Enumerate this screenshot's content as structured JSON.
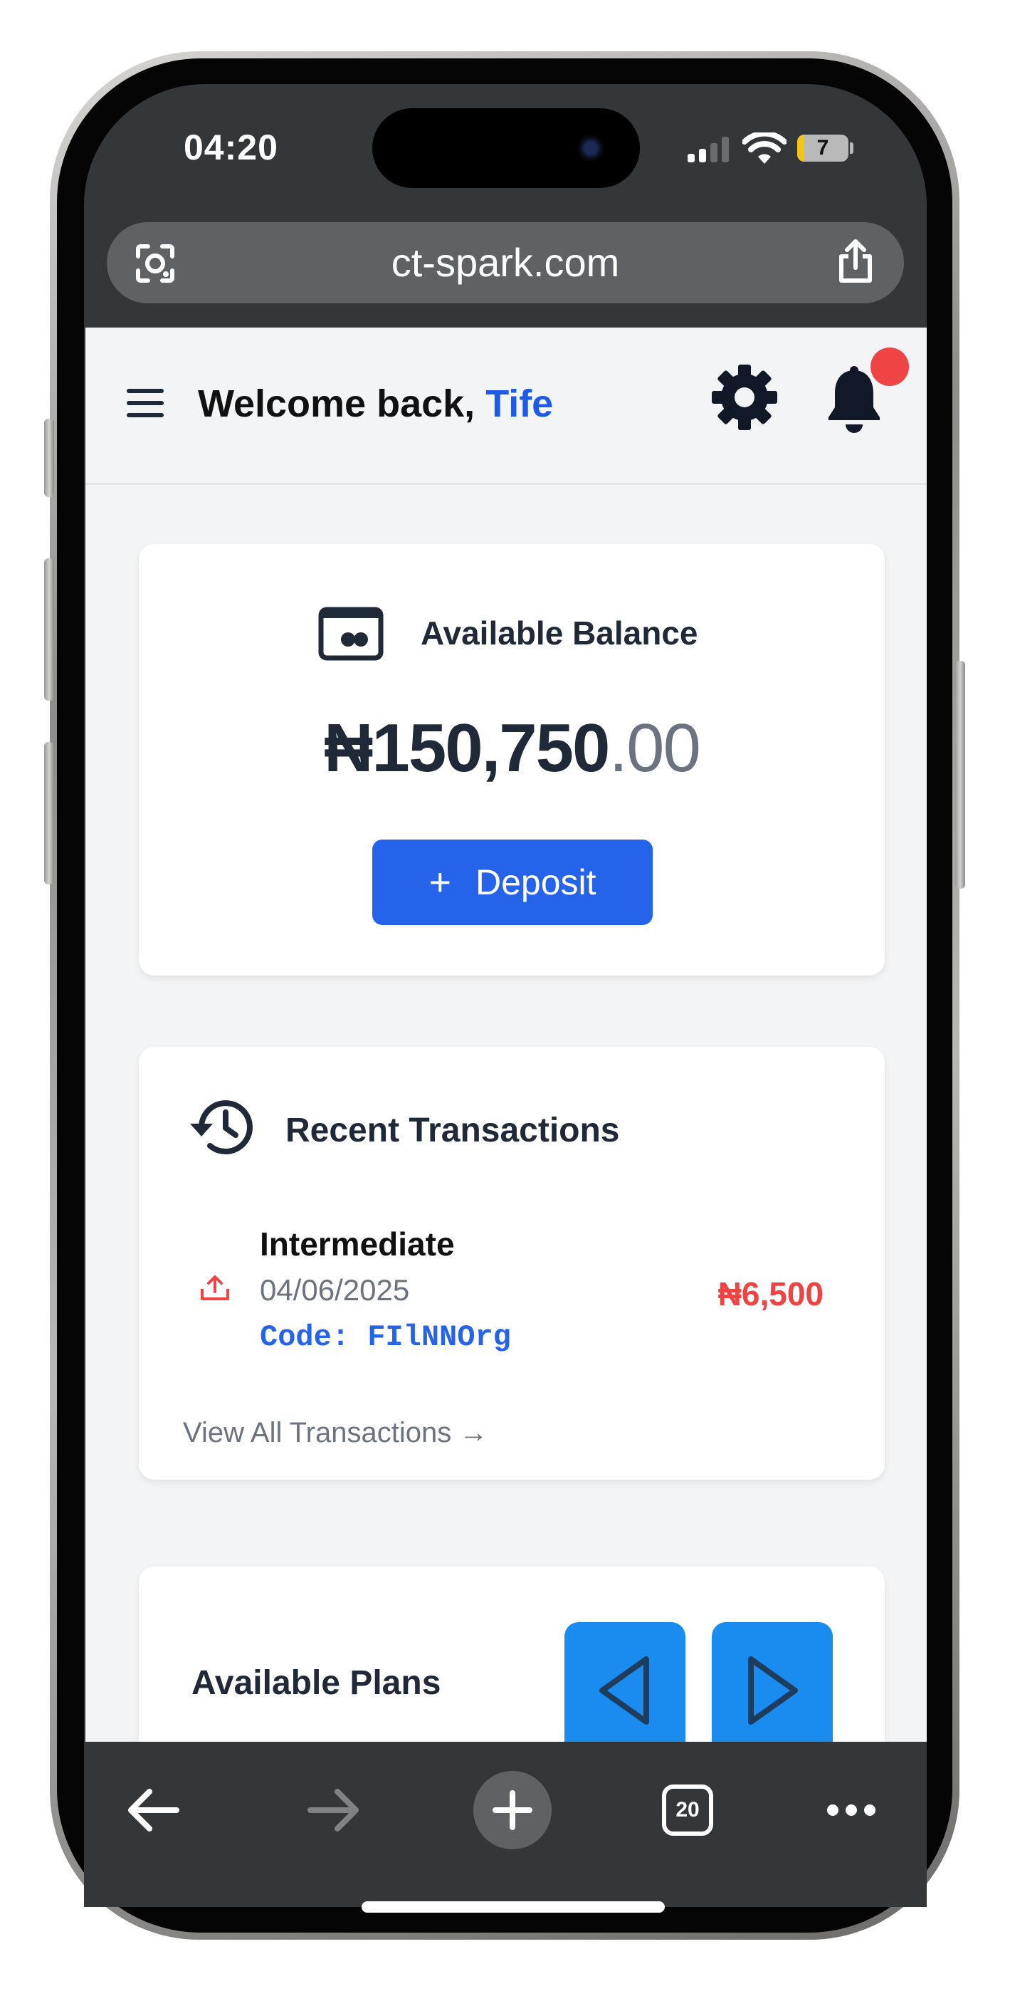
{
  "status_bar": {
    "time": "04:20",
    "battery": "7"
  },
  "browser": {
    "url": "ct-spark.com",
    "tab_count": "20"
  },
  "header": {
    "welcome_prefix": "Welcome back, ",
    "user_name": "Tife",
    "has_notifications": true
  },
  "balance": {
    "label": "Available Balance",
    "amount_main": "₦150,750",
    "amount_cents": ".00",
    "deposit_plus": "+",
    "deposit_label": "Deposit"
  },
  "transactions": {
    "title": "Recent Transactions",
    "items": [
      {
        "name": "Intermediate",
        "date": "04/06/2025",
        "code": "Code: FIlNNOrg",
        "amount": "₦6,500",
        "direction": "outgoing"
      }
    ],
    "view_all": "View All Transactions →"
  },
  "plans": {
    "title": "Available Plans"
  },
  "colors": {
    "accent": "#2563eb",
    "name_blue": "#1d5ae6",
    "negative": "#ef4444",
    "nav_button": "#1a8cf0",
    "page_bg": "#f3f4f6"
  },
  "icons": [
    "menu-icon",
    "gear-icon",
    "bell-icon",
    "wallet-icon",
    "history-icon",
    "upload-icon",
    "triangle-left-icon",
    "triangle-right-icon",
    "back-arrow-icon",
    "forward-arrow-icon",
    "plus-icon",
    "tabs-icon",
    "more-icon",
    "lens-icon",
    "share-icon",
    "signal-icon",
    "wifi-icon",
    "battery-icon"
  ]
}
